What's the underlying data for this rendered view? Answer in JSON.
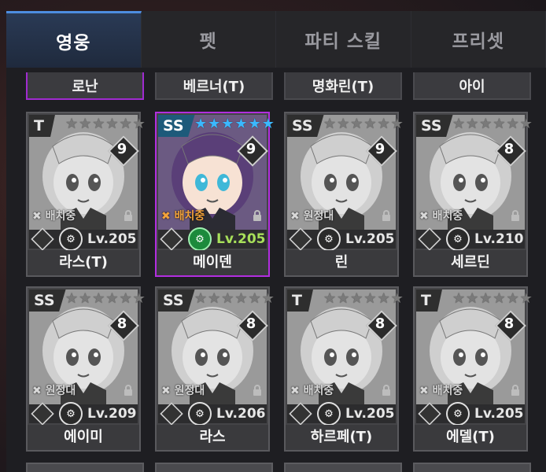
{
  "tabs": [
    {
      "label": "영웅",
      "active": true
    },
    {
      "label": "펫",
      "active": false
    },
    {
      "label": "파티 스킬",
      "active": false
    },
    {
      "label": "프리셋",
      "active": false
    }
  ],
  "prev_row": [
    "로난",
    "베르너(T)",
    "명화린(T)",
    "아이"
  ],
  "cards": [
    {
      "name": "라스(T)",
      "grade": "T",
      "stars": 0,
      "star_count": 6,
      "level_badge": "9",
      "status": "배치중",
      "level": "Lv.205",
      "active": false
    },
    {
      "name": "메이덴",
      "grade": "SS",
      "stars": 6,
      "star_count": 6,
      "level_badge": "9",
      "status": "배치중",
      "level": "Lv.205",
      "active": true
    },
    {
      "name": "린",
      "grade": "SS",
      "stars": 0,
      "star_count": 6,
      "level_badge": "9",
      "status": "원정대",
      "level": "Lv.205",
      "active": false
    },
    {
      "name": "세르딘",
      "grade": "SS",
      "stars": 0,
      "star_count": 6,
      "level_badge": "8",
      "status": "배치중",
      "level": "Lv.210",
      "active": false
    },
    {
      "name": "에이미",
      "grade": "SS",
      "stars": 0,
      "star_count": 6,
      "level_badge": "8",
      "status": "원정대",
      "level": "Lv.209",
      "active": false
    },
    {
      "name": "라스",
      "grade": "SS",
      "stars": 0,
      "star_count": 6,
      "level_badge": "8",
      "status": "원정대",
      "level": "Lv.206",
      "active": false
    },
    {
      "name": "하르페(T)",
      "grade": "T",
      "stars": 0,
      "star_count": 6,
      "level_badge": "8",
      "status": "배치중",
      "level": "Lv.205",
      "active": false
    },
    {
      "name": "에델(T)",
      "grade": "T",
      "stars": 0,
      "star_count": 6,
      "level_badge": "8",
      "status": "배치중",
      "level": "Lv.205",
      "active": false
    }
  ],
  "colors": {
    "accent": "#b22ee0",
    "star_active": "#3bb8ff",
    "level_active": "#a8e05a",
    "status_active": "#f2a23a"
  }
}
